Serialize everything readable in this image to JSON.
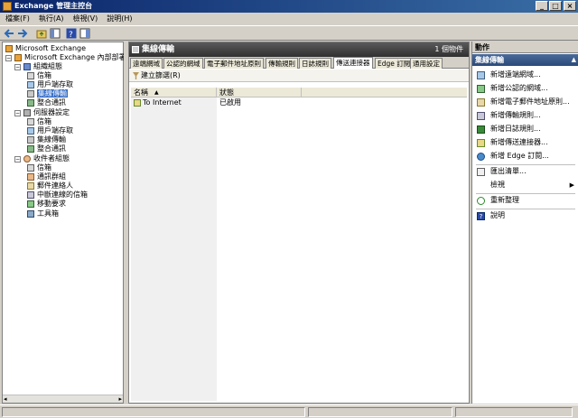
{
  "window": {
    "title": "Exchange 管理主控台"
  },
  "menu": [
    "檔案(F)",
    "執行(A)",
    "檢視(V)",
    "說明(H)"
  ],
  "tree": {
    "root": "Microsoft Exchange",
    "org": "Microsoft Exchange 內部部署 (w",
    "org_config": "組織組態",
    "org_children": [
      "信箱",
      "用戶端存取",
      "集線傳輸",
      "整合通訊"
    ],
    "server_config": "伺服器設定",
    "server_children": [
      "信箱",
      "用戶端存取",
      "集線傳輸",
      "整合通訊"
    ],
    "recipient_config": "收件者組態",
    "recipient_children": [
      "信箱",
      "通訊群組",
      "郵件連絡人",
      "中斷連線的信箱",
      "移動要求"
    ],
    "toolbox": "工具箱"
  },
  "center": {
    "title": "集線傳輸",
    "count": "1 個物件",
    "tabs": [
      "遠端網域",
      "公認的網域",
      "電子郵件地址原則",
      "傳輸規則",
      "日誌規則",
      "傳送連接器",
      "Edge 訂閱",
      "通用設定"
    ],
    "active_tab": 5,
    "filter_label": "建立篩選(R)",
    "columns": [
      "名稱",
      "狀態"
    ],
    "rows": [
      {
        "name": "To Internet",
        "status": "已啟用"
      }
    ]
  },
  "actions": {
    "header": "動作",
    "section": "集線傳輸",
    "items": [
      {
        "label": "新增遠端網域...",
        "icon": "remote-domain-icon"
      },
      {
        "label": "新增公認的網域...",
        "icon": "accepted-domain-icon"
      },
      {
        "label": "新增電子郵件地址原則...",
        "icon": "email-policy-icon"
      },
      {
        "label": "新增傳輸規則...",
        "icon": "transport-rule-icon"
      },
      {
        "label": "新增日誌規則...",
        "icon": "journal-rule-icon"
      },
      {
        "label": "新增傳送連接器...",
        "icon": "send-connector-icon"
      },
      {
        "label": "新增 Edge 訂閱...",
        "icon": "edge-subscription-icon"
      },
      {
        "label": "匯出清單...",
        "icon": "export-list-icon"
      },
      {
        "label": "檢視",
        "icon": ""
      },
      {
        "label": "重新整理",
        "icon": "refresh-icon"
      },
      {
        "label": "說明",
        "icon": "help-icon"
      }
    ]
  },
  "colors": {
    "title_bar": "#0a246a",
    "selection": "#316ac5",
    "pane_header": "#404040",
    "action_section": "#2a4a7a"
  }
}
